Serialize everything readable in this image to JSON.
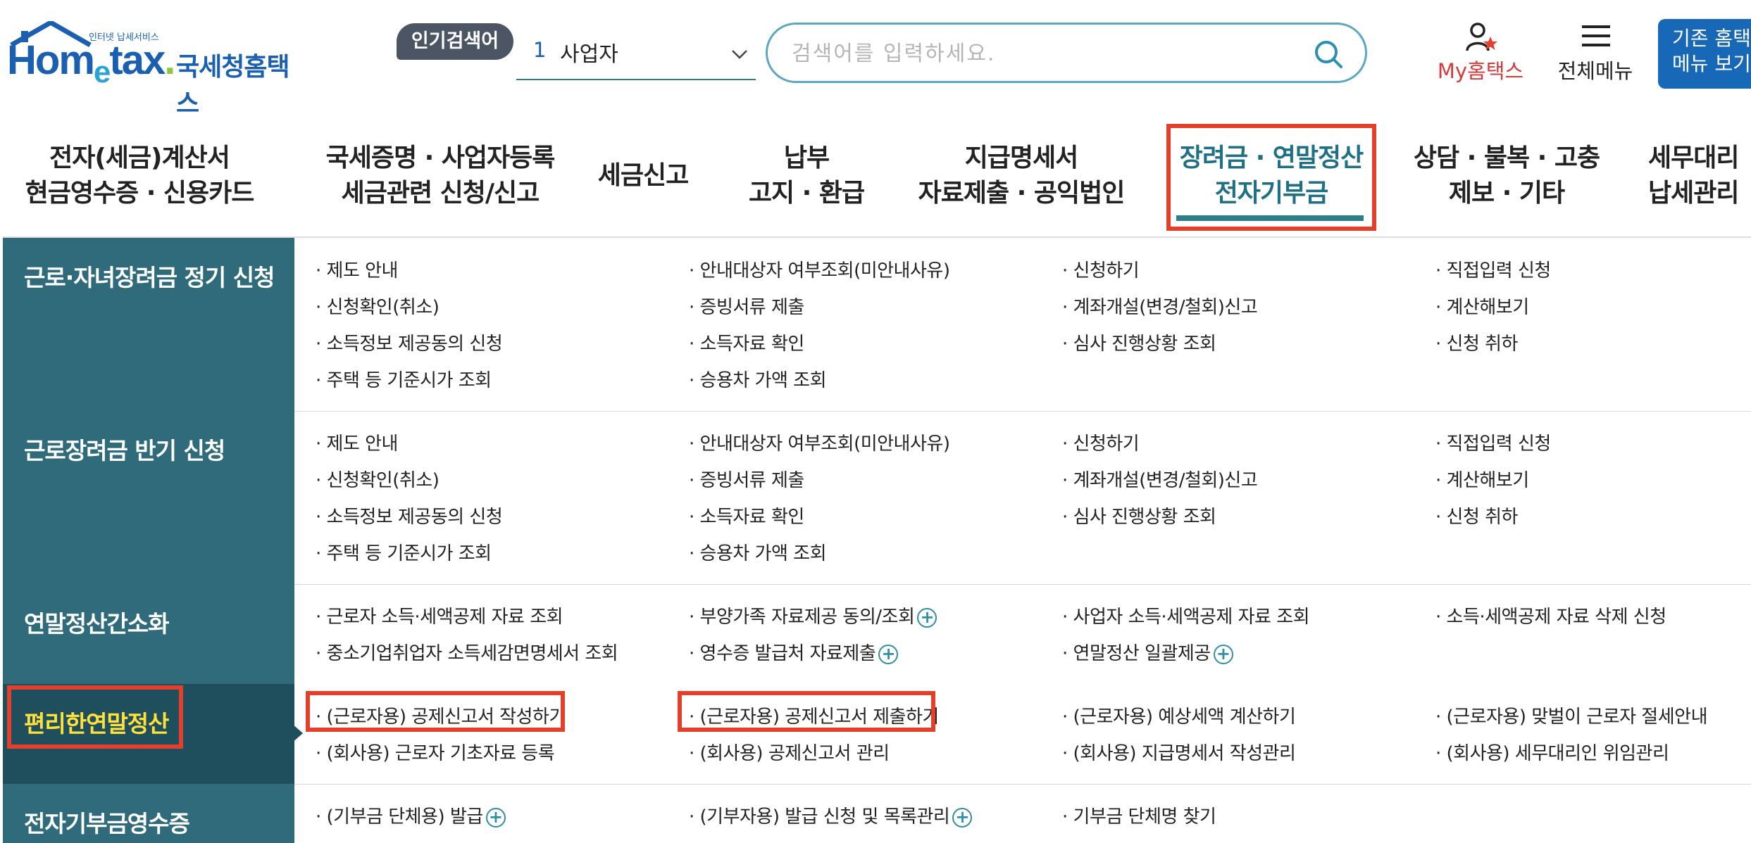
{
  "logo": {
    "small_text": "인터넷 납세서비스",
    "en_ho": "Hom",
    "en_e": "e",
    "en_tax": "tax",
    "en_dot": ".",
    "ko": "국세청홈택스"
  },
  "header": {
    "popular_badge": "인기검색어",
    "popular_rank": "1",
    "popular_keyword": "사업자",
    "search_placeholder": "검색어를 입력하세요.",
    "my_hometax": "My홈택스",
    "all_menu": "전체메뉴",
    "legacy_button": "기존 홈택스\n메뉴 보기"
  },
  "gnb": [
    {
      "label": "전자(세금)계산서\n현금영수증 · 신용카드",
      "active": false
    },
    {
      "label": "국세증명 · 사업자등록\n세금관련 신청/신고",
      "active": false
    },
    {
      "label": "세금신고",
      "active": false
    },
    {
      "label": "납부\n고지 · 환급",
      "active": false
    },
    {
      "label": "지급명세서\n자료제출 · 공익법인",
      "active": false
    },
    {
      "label": "장려금 · 연말정산\n전자기부금",
      "active": true
    },
    {
      "label": "상담 · 불복 · 고충\n제보 · 기타",
      "active": false
    },
    {
      "label": "세무대리\n납세관리",
      "active": false
    }
  ],
  "sections": [
    {
      "title": "근로·자녀장려금 정기 신청",
      "links": [
        "· 제도 안내",
        "· 안내대상자 여부조회(미안내사유)",
        "· 신청하기",
        "· 직접입력 신청",
        "· 신청확인(취소)",
        "· 증빙서류 제출",
        "· 계좌개설(변경/철회)신고",
        "· 계산해보기",
        "· 소득정보 제공동의 신청",
        "· 소득자료 확인",
        "· 심사 진행상황 조회",
        "· 신청 취하",
        "· 주택 등 기준시가 조회",
        "· 승용차 가액 조회"
      ]
    },
    {
      "title": "근로장려금 반기 신청",
      "links": [
        "· 제도 안내",
        "· 안내대상자 여부조회(미안내사유)",
        "· 신청하기",
        "· 직접입력 신청",
        "· 신청확인(취소)",
        "· 증빙서류 제출",
        "· 계좌개설(변경/철회)신고",
        "· 계산해보기",
        "· 소득정보 제공동의 신청",
        "· 소득자료 확인",
        "· 심사 진행상황 조회",
        "· 신청 취하",
        "· 주택 등 기준시가 조회",
        "· 승용차 가액 조회"
      ]
    },
    {
      "title": "연말정산간소화",
      "links": [
        "· 근로자 소득·세액공제 자료 조회",
        "· 부양가족 자료제공 동의/조회",
        "· 사업자 소득·세액공제 자료 조회",
        "· 소득·세액공제 자료 삭제 신청",
        "· 중소기업취업자 소득세감면명세서 조회",
        "· 영수증 발급처 자료제출",
        "· 연말정산 일괄제공"
      ]
    },
    {
      "title": "편리한연말정산",
      "links": [
        "· (근로자용) 공제신고서 작성하기",
        "· (근로자용) 공제신고서 제출하기",
        "· (근로자용) 예상세액 계산하기",
        "· (근로자용) 맞벌이 근로자 절세안내",
        "· (회사용) 근로자 기초자료 등록",
        "· (회사용) 공제신고서 관리",
        "· (회사용) 지급명세서 작성관리",
        "· (회사용) 세무대리인 위임관리"
      ]
    },
    {
      "title": "전자기부금영수증",
      "links": [
        "· (기부금 단체용) 발급",
        "· (기부자용) 발급 신청 및 목록관리",
        "· 기부금 단체명 찾기"
      ]
    }
  ],
  "plus_symbol": "+",
  "colors": {
    "accent_red": "#e3402c",
    "section_bg": "#2f6b7a",
    "active_section_bg": "#1f4f5c",
    "active_section_text": "#ffe13c",
    "brand_blue": "#1a5fb0"
  }
}
